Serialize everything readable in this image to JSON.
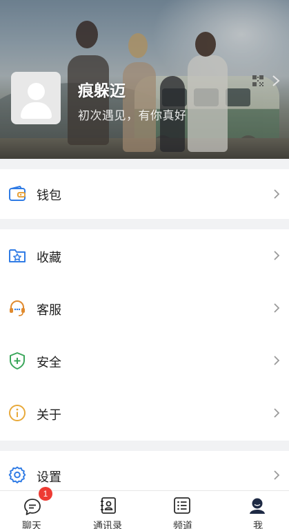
{
  "profile": {
    "name": "痕躲迈",
    "signature": "初次遇见，有你真好"
  },
  "menu": {
    "wallet": {
      "label": "钱包",
      "icon": "wallet-icon"
    },
    "favorites": {
      "label": "收藏",
      "icon": "favorites-folder-icon"
    },
    "customer_service": {
      "label": "客服",
      "icon": "headset-icon"
    },
    "security": {
      "label": "安全",
      "icon": "shield-plus-icon"
    },
    "about": {
      "label": "关于",
      "icon": "info-icon"
    },
    "settings": {
      "label": "设置",
      "icon": "gear-icon"
    }
  },
  "tabs": [
    {
      "label": "聊天",
      "icon": "chat-icon",
      "badge": "1"
    },
    {
      "label": "通讯录",
      "icon": "contacts-icon"
    },
    {
      "label": "频道",
      "icon": "channel-list-icon"
    },
    {
      "label": "我",
      "icon": "user-icon",
      "active": true
    }
  ],
  "colors": {
    "wallet": "#2f7be5",
    "favorites": "#2f7be5",
    "customer_service": "#e08a2e",
    "security": "#3aa65a",
    "about": "#e8a93a",
    "settings": "#2f7be5",
    "badge": "#ee3b33",
    "tab_active": "#1e2a44"
  }
}
